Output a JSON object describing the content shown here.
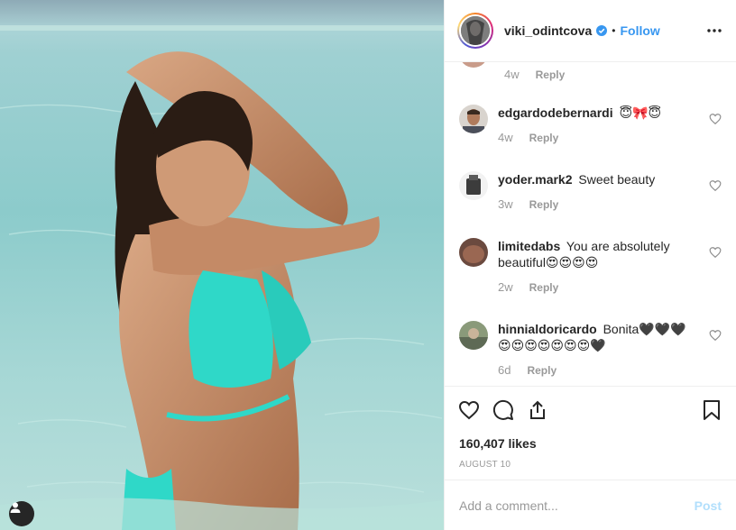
{
  "header": {
    "username": "viki_odintcova",
    "separator": "•",
    "follow_label": "Follow",
    "verified_icon": "verified-badge-icon",
    "more_icon": "more-options-icon"
  },
  "comments": {
    "partial": {
      "time": "4w",
      "reply": "Reply"
    },
    "items": [
      {
        "user": "edgardodebernardi",
        "text": "😇🎀😇",
        "time": "4w",
        "reply": "Reply"
      },
      {
        "user": "yoder.mark2",
        "text": "Sweet beauty",
        "time": "3w",
        "reply": "Reply"
      },
      {
        "user": "limitedabs",
        "text": "You are absolutely beautiful😍😍😍😍",
        "time": "2w",
        "reply": "Reply"
      },
      {
        "user": "hinnialdoricardo",
        "text": "Bonita🖤🖤🖤😍😍😍😍😍😍😍🖤",
        "time": "6d",
        "reply": "Reply"
      }
    ]
  },
  "actions": {
    "like_icon": "heart-icon",
    "comment_icon": "comment-icon",
    "share_icon": "share-icon",
    "save_icon": "bookmark-icon"
  },
  "likes": "160,407 likes",
  "date": "AUGUST 10",
  "add_comment": {
    "placeholder": "Add a comment...",
    "post_label": "Post"
  },
  "colors": {
    "link": "#3897f0",
    "post_disabled": "#b2dffc",
    "muted": "#999999",
    "text": "#262626",
    "water": "#8ccbcb",
    "bikini": "#2fd8c8"
  }
}
